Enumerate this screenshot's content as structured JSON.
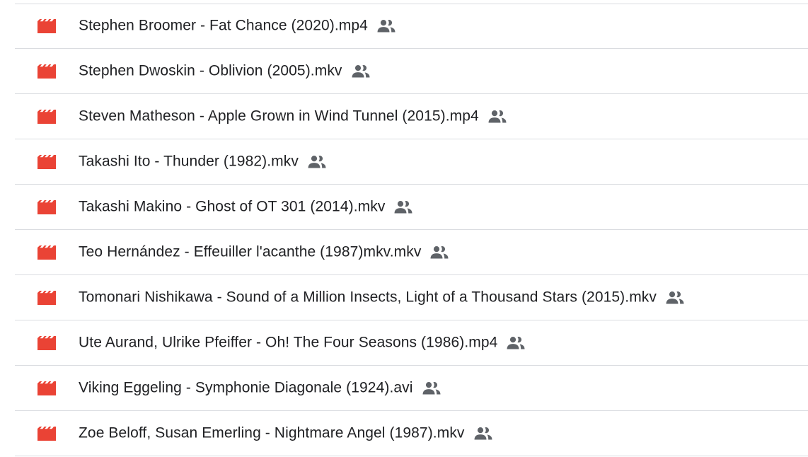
{
  "colors": {
    "video_icon": "#ea4335",
    "text": "#202124",
    "shared_icon": "#5f6368",
    "divider": "#dadce0"
  },
  "icons": {
    "file_type": "video-file-icon",
    "shared": "shared-people-icon"
  },
  "files": [
    {
      "name": "Stephen Broomer - Fat Chance (2020).mp4",
      "shared": true
    },
    {
      "name": "Stephen Dwoskin - Oblivion (2005).mkv",
      "shared": true
    },
    {
      "name": "Steven Matheson -  Apple Grown in Wind Tunnel (2015).mp4",
      "shared": true
    },
    {
      "name": "Takashi Ito - Thunder (1982).mkv",
      "shared": true
    },
    {
      "name": "Takashi Makino - Ghost of OT 301 (2014).mkv",
      "shared": true
    },
    {
      "name": "Teo Hernández - Effeuiller l'acanthe (1987)mkv.mkv",
      "shared": true
    },
    {
      "name": "Tomonari Nishikawa -  Sound of a Million Insects, Light of a Thousand Stars (2015).mkv",
      "shared": true
    },
    {
      "name": "Ute Aurand, Ulrike Pfeiffer - Oh! The Four Seasons (1986).mp4",
      "shared": true
    },
    {
      "name": "Viking Eggeling - Symphonie Diagonale (1924).avi",
      "shared": true
    },
    {
      "name": "Zoe Beloff, Susan Emerling - Nightmare Angel (1987).mkv",
      "shared": true
    }
  ]
}
